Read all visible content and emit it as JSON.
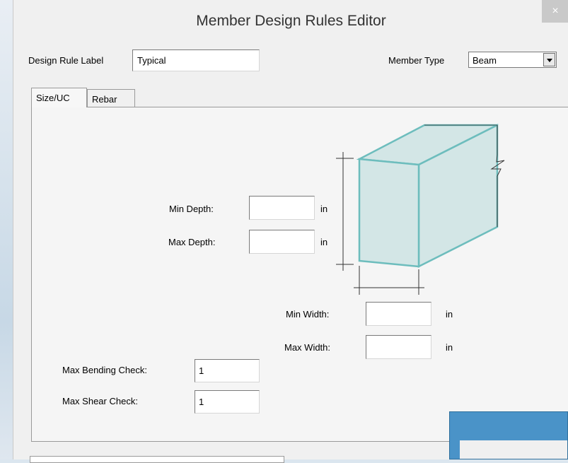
{
  "window": {
    "title": "Member Design Rules Editor",
    "close_glyph": "×"
  },
  "header": {
    "design_rule_label": "Design Rule Label",
    "design_rule_value": "Typical",
    "member_type_label": "Member Type",
    "member_type_value": "Beam"
  },
  "tabs": [
    {
      "label": "Size/UC",
      "active": true
    },
    {
      "label": "Rebar",
      "active": false
    }
  ],
  "size_uc": {
    "min_depth_label": "Min Depth:",
    "min_depth_value": "",
    "max_depth_label": "Max Depth:",
    "max_depth_value": "",
    "min_width_label": "Min Width:",
    "min_width_value": "",
    "max_width_label": "Max Width:",
    "max_width_value": "",
    "unit": "in",
    "max_bending_label": "Max Bending Check:",
    "max_bending_value": "1",
    "max_shear_label": "Max Shear Check:",
    "max_shear_value": "1"
  },
  "diagram": {
    "icon": "beam-section-diagram-icon",
    "face_color": "#d3e6e6",
    "edge_color": "#6dbdbd"
  }
}
